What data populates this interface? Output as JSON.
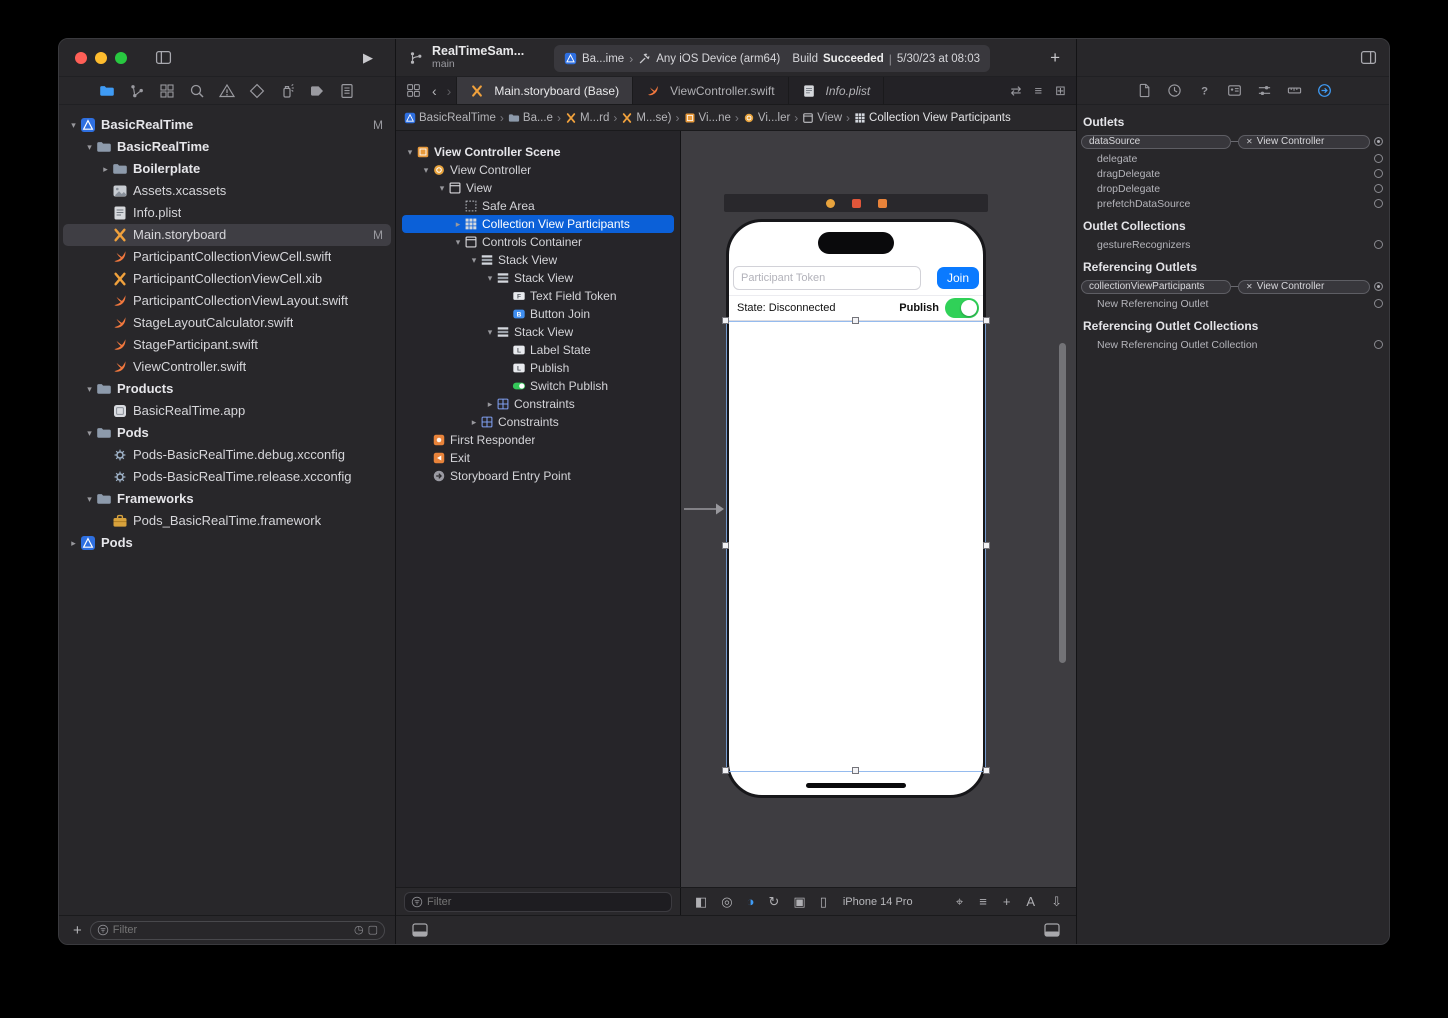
{
  "titlebar": {
    "project": "RealTimeSam...",
    "branch": "main",
    "status": {
      "scheme": "Ba...ime",
      "destination": "Any iOS Device (arm64)",
      "build_label": "Build",
      "build_result": "Succeeded",
      "divider": "|",
      "build_time": "5/30/23 at 08:03"
    }
  },
  "navigator": {
    "tabs": [
      {
        "icon": "project-navigator-icon",
        "selected": true
      },
      {
        "icon": "source-control-navigator-icon"
      },
      {
        "icon": "symbol-navigator-icon"
      },
      {
        "icon": "find-navigator-icon"
      },
      {
        "icon": "issue-navigator-icon"
      },
      {
        "icon": "test-navigator-icon"
      },
      {
        "icon": "debug-navigator-icon"
      },
      {
        "icon": "breakpoint-navigator-icon"
      },
      {
        "icon": "report-navigator-icon"
      }
    ],
    "files": [
      {
        "label": "BasicRealTime",
        "icon": "xcode-project-icon",
        "level": 0,
        "chevron": "expanded",
        "badge": "M",
        "bold": true
      },
      {
        "label": "BasicRealTime",
        "icon": "folder-icon",
        "level": 1,
        "chevron": "expanded",
        "bold": true
      },
      {
        "label": "Boilerplate",
        "icon": "folder-icon",
        "level": 2,
        "chevron": "collapsed",
        "bold": true
      },
      {
        "label": "Assets.xcassets",
        "icon": "assets-icon",
        "level": 2
      },
      {
        "label": "Info.plist",
        "icon": "plist-icon",
        "level": 2
      },
      {
        "label": "Main.storyboard",
        "icon": "storyboard-file-icon",
        "level": 2,
        "badge": "M",
        "selected": true
      },
      {
        "label": "ParticipantCollectionViewCell.swift",
        "icon": "swift-file-icon",
        "level": 2
      },
      {
        "label": "ParticipantCollectionViewCell.xib",
        "icon": "xib-file-icon",
        "level": 2
      },
      {
        "label": "ParticipantCollectionViewLayout.swift",
        "icon": "swift-file-icon",
        "level": 2
      },
      {
        "label": "StageLayoutCalculator.swift",
        "icon": "swift-file-icon",
        "level": 2
      },
      {
        "label": "StageParticipant.swift",
        "icon": "swift-file-icon",
        "level": 2
      },
      {
        "label": "ViewController.swift",
        "icon": "swift-file-icon",
        "level": 2
      },
      {
        "label": "Products",
        "icon": "folder-icon",
        "level": 1,
        "chevron": "expanded",
        "bold": true
      },
      {
        "label": "BasicRealTime.app",
        "icon": "app-icon",
        "level": 2
      },
      {
        "label": "Pods",
        "icon": "folder-icon",
        "level": 1,
        "chevron": "expanded",
        "bold": true
      },
      {
        "label": "Pods-BasicRealTime.debug.xcconfig",
        "icon": "xcconfig-icon",
        "level": 2
      },
      {
        "label": "Pods-BasicRealTime.release.xcconfig",
        "icon": "xcconfig-icon",
        "level": 2
      },
      {
        "label": "Frameworks",
        "icon": "folder-icon",
        "level": 1,
        "chevron": "expanded",
        "bold": true
      },
      {
        "label": "Pods_BasicRealTime.framework",
        "icon": "framework-icon",
        "level": 2
      },
      {
        "label": "Pods",
        "icon": "xcode-project-icon",
        "level": 0,
        "chevron": "collapsed",
        "bold": true
      }
    ],
    "filter_placeholder": "Filter"
  },
  "tabbar": {
    "tabs": [
      {
        "icon": "storyboard-file-icon",
        "label": "Main.storyboard (Base)",
        "active": true
      },
      {
        "icon": "swift-file-icon",
        "label": "ViewController.swift"
      },
      {
        "icon": "plist-icon",
        "label": "Info.plist",
        "italic": true
      }
    ]
  },
  "jumpbar": {
    "items": [
      {
        "icon": "xcode-project-icon",
        "label": "BasicRealTime"
      },
      {
        "icon": "folder-icon",
        "label": "Ba...e"
      },
      {
        "icon": "storyboard-file-icon",
        "label": "M...rd"
      },
      {
        "icon": "storyboard-file-icon",
        "label": "M...se)"
      },
      {
        "icon": "scene-icon",
        "label": "Vi...ne"
      },
      {
        "icon": "view-controller-icon",
        "label": "Vi...ler"
      },
      {
        "icon": "view-icon",
        "label": "View"
      },
      {
        "icon": "collection-view-icon",
        "label": "Collection View Participants"
      }
    ]
  },
  "outline": {
    "items": [
      {
        "label": "View Controller Scene",
        "icon": "scene-icon",
        "level": 0,
        "chevron": "expanded",
        "bold": true
      },
      {
        "label": "View Controller",
        "icon": "view-controller-icon",
        "level": 1,
        "chevron": "expanded"
      },
      {
        "label": "View",
        "icon": "view-icon",
        "level": 2,
        "chevron": "expanded"
      },
      {
        "label": "Safe Area",
        "icon": "safe-area-icon",
        "level": 3
      },
      {
        "label": "Collection View Participants",
        "icon": "collection-view-icon",
        "level": 3,
        "chevron": "collapsed",
        "selected": true
      },
      {
        "label": "Controls Container",
        "icon": "view-icon",
        "level": 3,
        "chevron": "expanded"
      },
      {
        "label": "Stack View",
        "icon": "stack-view-icon",
        "level": 4,
        "chevron": "expanded"
      },
      {
        "label": "Stack View",
        "icon": "stack-view-icon",
        "level": 5,
        "chevron": "expanded"
      },
      {
        "label": "Text Field Token",
        "icon": "text-field-icon",
        "level": 6
      },
      {
        "label": "Button Join",
        "icon": "button-icon",
        "level": 6
      },
      {
        "label": "Stack View",
        "icon": "stack-view-icon",
        "level": 5,
        "chevron": "expanded"
      },
      {
        "label": "Label State",
        "icon": "label-icon",
        "level": 6
      },
      {
        "label": "Publish",
        "icon": "label-icon",
        "level": 6
      },
      {
        "label": "Switch Publish",
        "icon": "switch-icon",
        "level": 6
      },
      {
        "label": "Constraints",
        "icon": "constraints-icon",
        "level": 5,
        "chevron": "collapsed"
      },
      {
        "label": "Constraints",
        "icon": "constraints-icon",
        "level": 4,
        "chevron": "collapsed"
      },
      {
        "label": "First Responder",
        "icon": "first-responder-icon",
        "level": 1
      },
      {
        "label": "Exit",
        "icon": "exit-icon",
        "level": 1
      },
      {
        "label": "Storyboard Entry Point",
        "icon": "entry-point-icon",
        "level": 1
      }
    ],
    "filter_placeholder": "Filter"
  },
  "canvas": {
    "scene_dock": [
      {
        "icon": "view-controller-dock-icon",
        "shape": "circle",
        "color": "#e8a33d"
      },
      {
        "icon": "first-responder-dock-icon",
        "shape": "square",
        "color": "#e0563a"
      },
      {
        "icon": "exit-dock-icon",
        "shape": "square",
        "color": "#e8833a"
      }
    ],
    "device": {
      "textfield_placeholder": "Participant Token",
      "join_label": "Join",
      "state_label": "State: Disconnected",
      "publish_label": "Publish"
    },
    "device_bar": {
      "device_name": "iPhone 14 Pro",
      "left_icons": [
        {
          "icon": "canvas-outline-toggle-icon",
          "glyph": "◧"
        },
        {
          "icon": "issues-icon",
          "glyph": "◎"
        },
        {
          "icon": "color-scheme-icon",
          "glyph": "◑",
          "accent": true
        },
        {
          "icon": "orientation-icon",
          "glyph": "↻"
        },
        {
          "icon": "windows-icon",
          "glyph": "▣"
        },
        {
          "icon": "device-icon",
          "glyph": "▯"
        }
      ],
      "right_icons": [
        {
          "icon": "zoom-selection-icon",
          "glyph": "⌖"
        },
        {
          "icon": "alignment-icon",
          "glyph": "≡"
        },
        {
          "icon": "pan-icon",
          "glyph": "+"
        },
        {
          "icon": "dynamic-type-icon",
          "glyph": "A"
        },
        {
          "icon": "export-icon",
          "glyph": "⇩"
        }
      ]
    }
  },
  "inspector": {
    "tabs": [
      {
        "icon": "file-inspector-icon"
      },
      {
        "icon": "history-inspector-icon"
      },
      {
        "icon": "quick-help-inspector-icon"
      },
      {
        "icon": "identity-inspector-icon"
      },
      {
        "icon": "attributes-inspector-icon"
      },
      {
        "icon": "size-inspector-icon"
      },
      {
        "icon": "connections-inspector-icon",
        "selected": true
      }
    ],
    "sections": [
      {
        "title": "Outlets",
        "rows": [
          {
            "type": "connected",
            "label": "dataSource",
            "target": "View Controller"
          },
          {
            "type": "plain",
            "label": "delegate"
          },
          {
            "type": "plain",
            "label": "dragDelegate"
          },
          {
            "type": "plain",
            "label": "dropDelegate"
          },
          {
            "type": "plain",
            "label": "prefetchDataSource"
          }
        ]
      },
      {
        "title": "Outlet Collections",
        "rows": [
          {
            "type": "plain",
            "label": "gestureRecognizers"
          }
        ]
      },
      {
        "title": "Referencing Outlets",
        "rows": [
          {
            "type": "connected",
            "label": "collectionViewParticipants",
            "target": "View Controller"
          },
          {
            "type": "plain",
            "label": "New Referencing Outlet"
          }
        ]
      },
      {
        "title": "Referencing Outlet Collections",
        "rows": [
          {
            "type": "plain",
            "label": "New Referencing Outlet Collection"
          }
        ]
      }
    ]
  }
}
